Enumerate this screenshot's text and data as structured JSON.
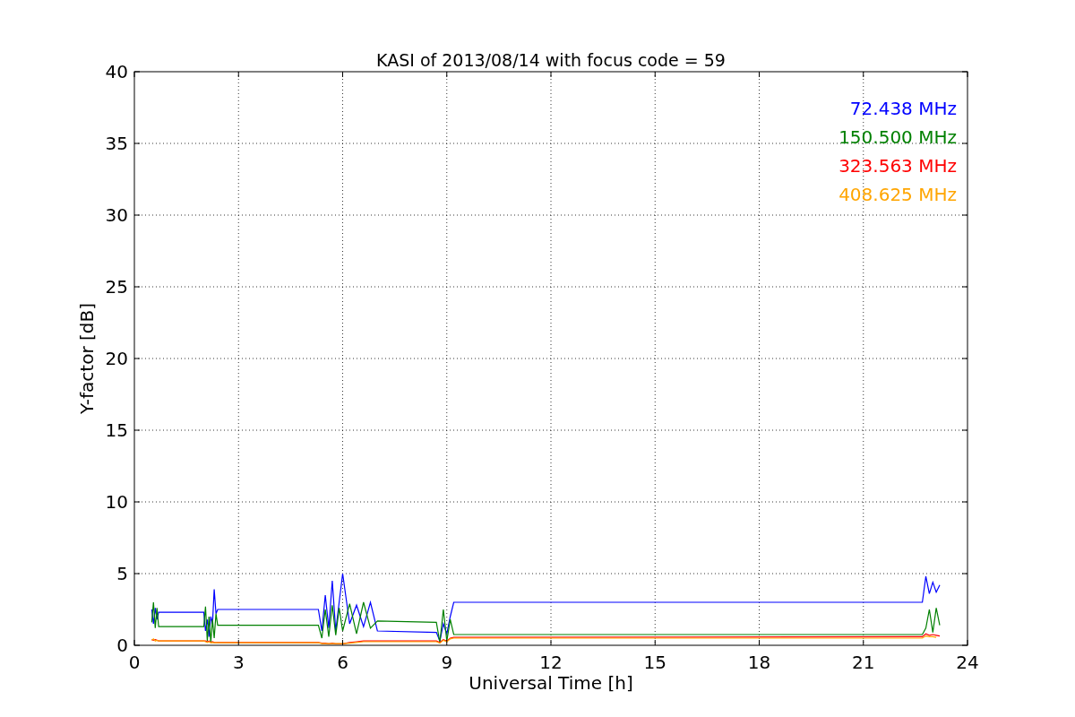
{
  "chart_data": {
    "type": "line",
    "title": "KASI of 2013/08/14 with focus code = 59",
    "xlabel": "Universal Time [h]",
    "ylabel": "Y-factor [dB]",
    "xlim": [
      0,
      24
    ],
    "ylim": [
      0,
      40
    ],
    "xticks": [
      0,
      3,
      6,
      9,
      12,
      15,
      18,
      21,
      24
    ],
    "yticks": [
      0,
      5,
      10,
      15,
      20,
      25,
      30,
      35,
      40
    ],
    "grid": true,
    "x": [
      0.5,
      0.55,
      0.6,
      0.65,
      0.7,
      2.0,
      2.05,
      2.1,
      2.15,
      2.2,
      2.25,
      2.3,
      2.35,
      2.4,
      5.3,
      5.4,
      5.5,
      5.6,
      5.7,
      5.8,
      5.9,
      6.0,
      6.2,
      6.4,
      6.6,
      6.8,
      7.0,
      8.7,
      8.8,
      8.9,
      9.0,
      9.1,
      9.2,
      22.7,
      22.8,
      22.9,
      23.0,
      23.1,
      23.2
    ],
    "series": [
      {
        "name": "72.438 MHz",
        "color": "#0000ff",
        "values": [
          2.5,
          1.5,
          2.6,
          1.8,
          2.3,
          2.3,
          1.0,
          1.8,
          0.6,
          2.0,
          1.5,
          3.9,
          2.2,
          2.5,
          2.5,
          1.0,
          3.5,
          1.2,
          4.5,
          1.0,
          3.0,
          5.0,
          1.5,
          2.8,
          1.3,
          3.0,
          1.0,
          0.9,
          0.3,
          1.5,
          0.8,
          2.0,
          3.0,
          3.0,
          4.8,
          3.6,
          4.4,
          3.7,
          4.2
        ]
      },
      {
        "name": "150.500 MHz",
        "color": "#008000",
        "values": [
          1.6,
          3.0,
          1.2,
          2.6,
          1.3,
          1.3,
          2.7,
          0.3,
          2.0,
          0.2,
          1.8,
          0.5,
          2.2,
          1.4,
          1.4,
          0.5,
          2.5,
          0.6,
          2.8,
          0.7,
          2.6,
          1.0,
          2.9,
          0.8,
          3.0,
          1.2,
          1.7,
          1.6,
          0.2,
          2.5,
          0.3,
          1.8,
          0.75,
          0.75,
          1.2,
          2.5,
          0.9,
          2.6,
          1.4
        ]
      },
      {
        "name": "323.563 MHz",
        "color": "#ff0000",
        "values": [
          0.4,
          0.35,
          0.4,
          0.35,
          0.3,
          0.3,
          0.3,
          0.25,
          0.3,
          0.2,
          0.25,
          0.2,
          0.2,
          0.2,
          0.2,
          0.15,
          0.15,
          0.1,
          0.15,
          0.1,
          0.1,
          0.1,
          0.2,
          0.25,
          0.3,
          0.3,
          0.3,
          0.3,
          0.2,
          0.4,
          0.3,
          0.5,
          0.55,
          0.6,
          0.8,
          0.7,
          0.75,
          0.7,
          0.65
        ]
      },
      {
        "name": "408.625 MHz",
        "color": "#ffa500",
        "values": [
          0.35,
          0.45,
          0.3,
          0.35,
          0.3,
          0.3,
          0.25,
          0.2,
          0.25,
          0.18,
          0.2,
          0.18,
          0.2,
          0.18,
          0.18,
          0.12,
          0.12,
          0.12,
          0.12,
          0.12,
          0.12,
          0.12,
          0.15,
          0.2,
          0.25,
          0.25,
          0.25,
          0.25,
          0.15,
          0.35,
          0.25,
          0.45,
          0.5,
          0.5,
          0.65,
          0.6,
          0.6,
          0.55,
          null
        ]
      }
    ]
  }
}
